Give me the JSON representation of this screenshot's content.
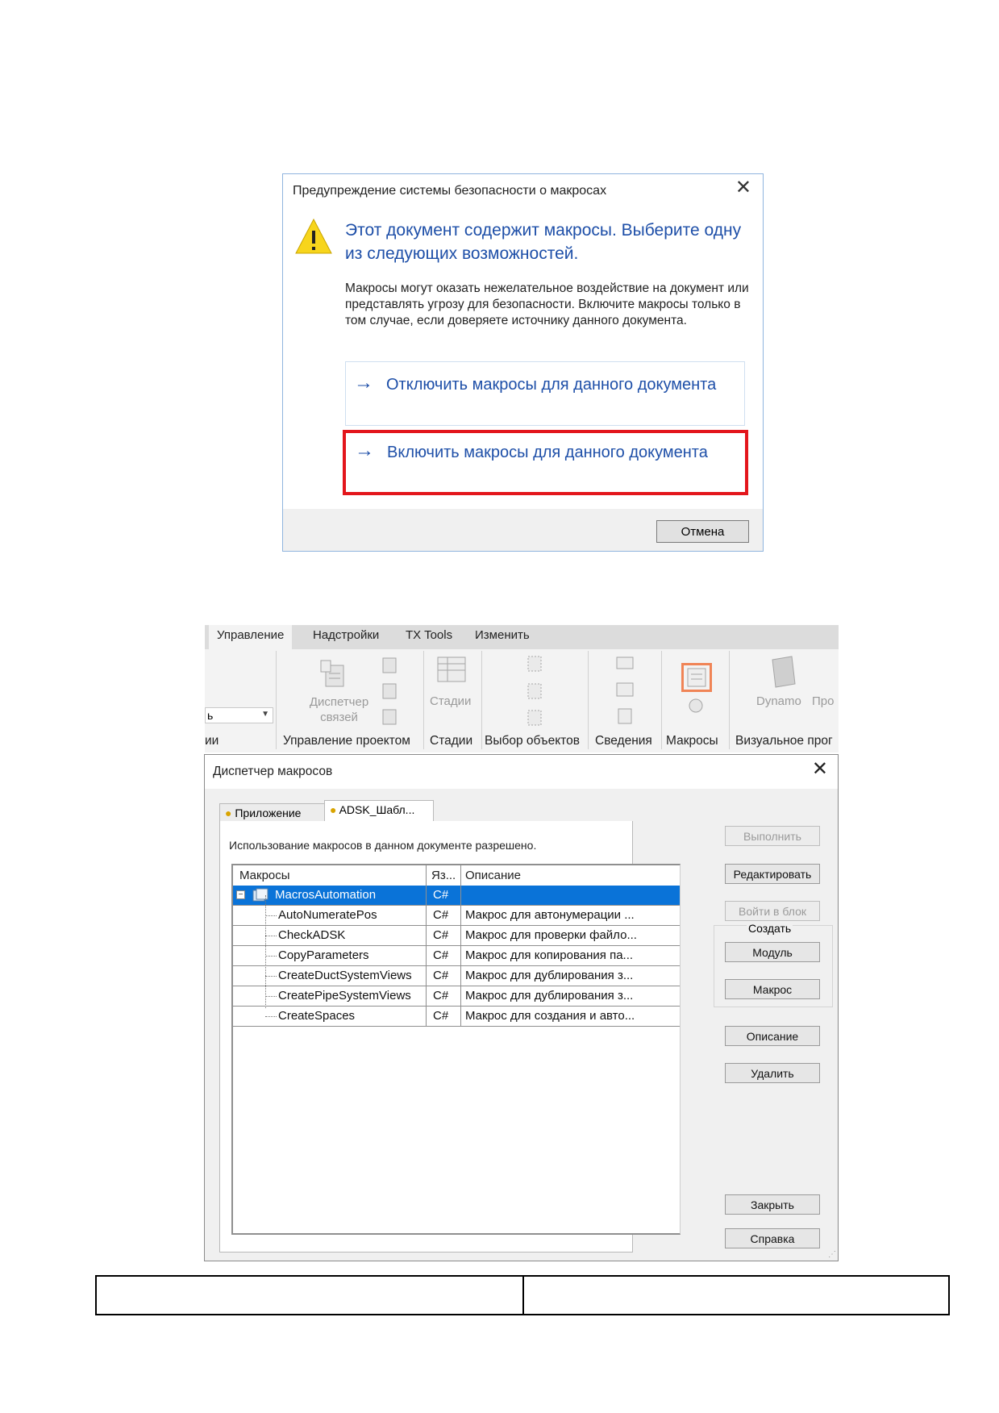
{
  "security_dialog": {
    "title": "Предупреждение системы безопасности о макросах",
    "close": "✕",
    "heading": "Этот документ содержит макросы. Выберите одну из следующих возможностей.",
    "body": "Макросы могут оказать нежелательное воздействие на документ или представлять угрозу для безопасности. Включите макросы только в том случае, если доверяете источнику данного документа.",
    "option_disable": "Отключить макросы для данного документа",
    "option_enable": "Включить макросы для данного документа",
    "arrow": "→",
    "cancel": "Отмена",
    "icon": "warning-icon",
    "highlight_color": "#e3161c",
    "accent_color": "#1e4fa8"
  },
  "ribbon": {
    "tabs": [
      "Управление",
      "Надстройки",
      "TX Tools",
      "Изменить"
    ],
    "buttons": {
      "links_manager": "Диспетчер связей",
      "phases": "Стадии",
      "dynamo": "Dynamo",
      "dynamo_player": "Про"
    },
    "groups": [
      "ии",
      "Управление проектом",
      "Стадии",
      "Выбор объектов",
      "Сведения",
      "Макросы",
      "Визуальное прог"
    ],
    "dropdown_partial": "ь"
  },
  "macro_manager": {
    "title": "Диспетчер макросов",
    "close": "✕",
    "tabs": [
      "Приложение",
      "ADSK_Шабл..."
    ],
    "status": "Использование макросов в данном документе разрешено.",
    "columns": [
      "Макросы",
      "Яз...",
      "Описание"
    ],
    "rows": [
      {
        "name": "MacrosAutomation",
        "lang": "C#",
        "desc": "",
        "selected": true,
        "root": true
      },
      {
        "name": "AutoNumeratePos",
        "lang": "C#",
        "desc": "Макрос для автонумерации ..."
      },
      {
        "name": "CheckADSK",
        "lang": "C#",
        "desc": "Макрос для проверки файло..."
      },
      {
        "name": "CopyParameters",
        "lang": "C#",
        "desc": "Макрос для копирования па..."
      },
      {
        "name": "CreateDuctSystemViews",
        "lang": "C#",
        "desc": "Макрос для дублирования з..."
      },
      {
        "name": "CreatePipeSystemViews",
        "lang": "C#",
        "desc": "Макрос для дублирования з..."
      },
      {
        "name": "CreateSpaces",
        "lang": "C#",
        "desc": "Макрос для создания и авто..."
      }
    ],
    "buttons": {
      "run": "Выполнить",
      "edit": "Редактировать",
      "step_into": "Войти в блок",
      "create_group": "Создать",
      "module": "Модуль",
      "macro": "Макрос",
      "description": "Описание",
      "delete": "Удалить",
      "close": "Закрыть",
      "help": "Справка"
    },
    "selection_color": "#0a73d8"
  }
}
